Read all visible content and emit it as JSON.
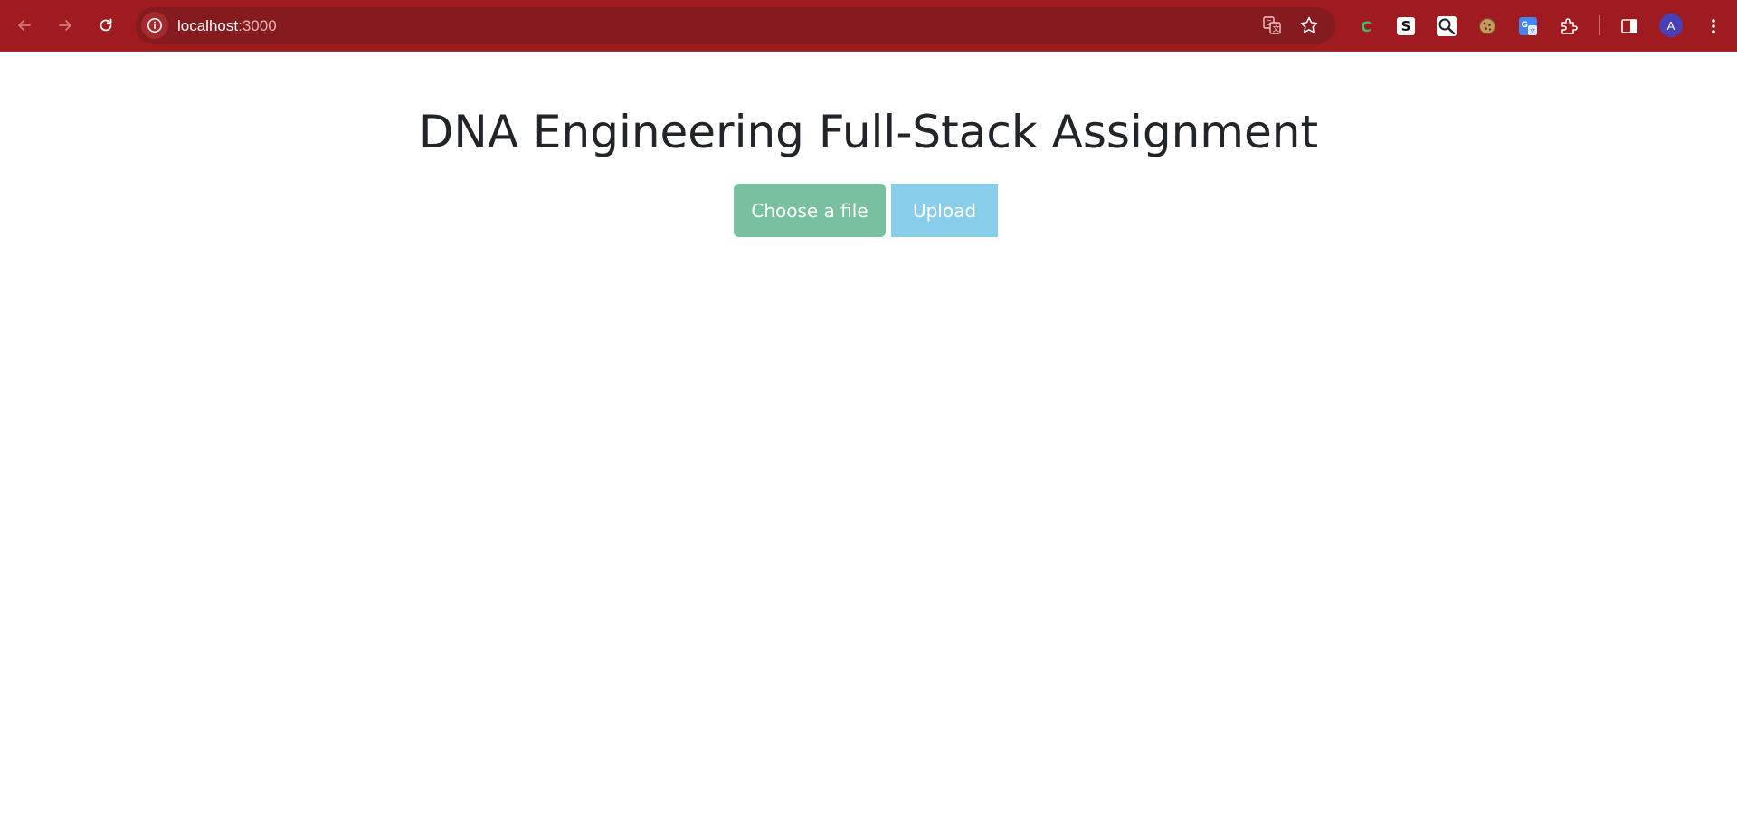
{
  "browser": {
    "back_icon": "arrow-left-icon",
    "forward_icon": "arrow-right-icon",
    "reload_icon": "reload-icon",
    "url_host": "localhost",
    "url_port": ":3000",
    "translate_icon": "translate-icon",
    "bookmark_icon": "star-icon",
    "extensions": [
      {
        "name": "c-extension-icon",
        "label": "C"
      },
      {
        "name": "s-extension-icon",
        "label": "S"
      },
      {
        "name": "magnifier-extension-icon"
      },
      {
        "name": "cookie-extension-icon"
      },
      {
        "name": "google-translate-extension-icon"
      },
      {
        "name": "puzzle-extensions-icon"
      }
    ],
    "side_panel_icon": "side-panel-icon",
    "profile_initial": "A",
    "menu_icon": "kebab-menu-icon",
    "colors": {
      "toolbar": "#9f1b1f",
      "omnibox": "#861b1f"
    }
  },
  "page": {
    "title": "DNA Engineering Full-Stack Assignment",
    "choose_file_label": "Choose a file",
    "upload_label": "Upload",
    "colors": {
      "choose_button": "#79c0a0",
      "upload_button": "#88cdea",
      "title_text": "#212529"
    }
  }
}
